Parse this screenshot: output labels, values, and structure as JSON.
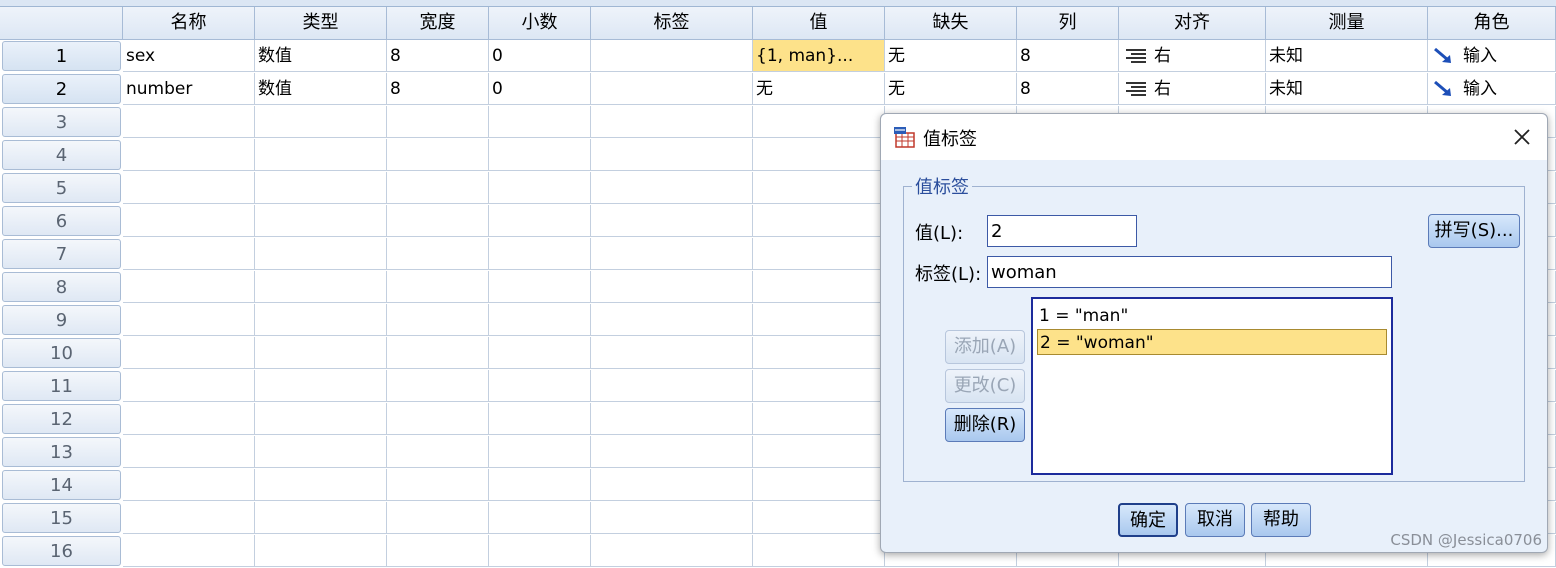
{
  "columns": [
    "名称",
    "类型",
    "宽度",
    "小数",
    "标签",
    "值",
    "缺失",
    "列",
    "对齐",
    "测量",
    "角色"
  ],
  "rows": [
    {
      "num": "1",
      "name": "sex",
      "type": "数值",
      "width": "8",
      "decimals": "0",
      "label": "",
      "values": "{1, man}...",
      "missing": "无",
      "columns": "8",
      "align": "右",
      "measure": "未知",
      "role": "输入"
    },
    {
      "num": "2",
      "name": "number",
      "type": "数值",
      "width": "8",
      "decimals": "0",
      "label": "",
      "values": "无",
      "missing": "无",
      "columns": "8",
      "align": "右",
      "measure": "未知",
      "role": "输入"
    }
  ],
  "empty_rows": [
    "3",
    "4",
    "5",
    "6",
    "7",
    "8",
    "9",
    "10",
    "11",
    "12",
    "13",
    "14",
    "15",
    "16"
  ],
  "dialog": {
    "title": "值标签",
    "group_title": "值标签",
    "value_label": "值(L):",
    "value_input": "2",
    "label_label": "标签(L):",
    "label_input": "woman",
    "spell_button": "拼写(S)...",
    "add_button": "添加(A)",
    "change_button": "更改(C)",
    "delete_button": "删除(R)",
    "list": [
      "1 = \"man\"",
      "2 = \"woman\""
    ],
    "ok_button": "确定",
    "cancel_button": "取消",
    "help_button": "帮助"
  },
  "watermark": "CSDN @Jessica0706",
  "colors": {
    "selection": "#fde28a",
    "accent": "#1f3f8a",
    "arrow": "#1d4fb8"
  },
  "icons": {
    "align": "align-right-icon",
    "role": "input-arrow-icon",
    "dialog": "value-labels-icon",
    "close": "close-icon"
  }
}
